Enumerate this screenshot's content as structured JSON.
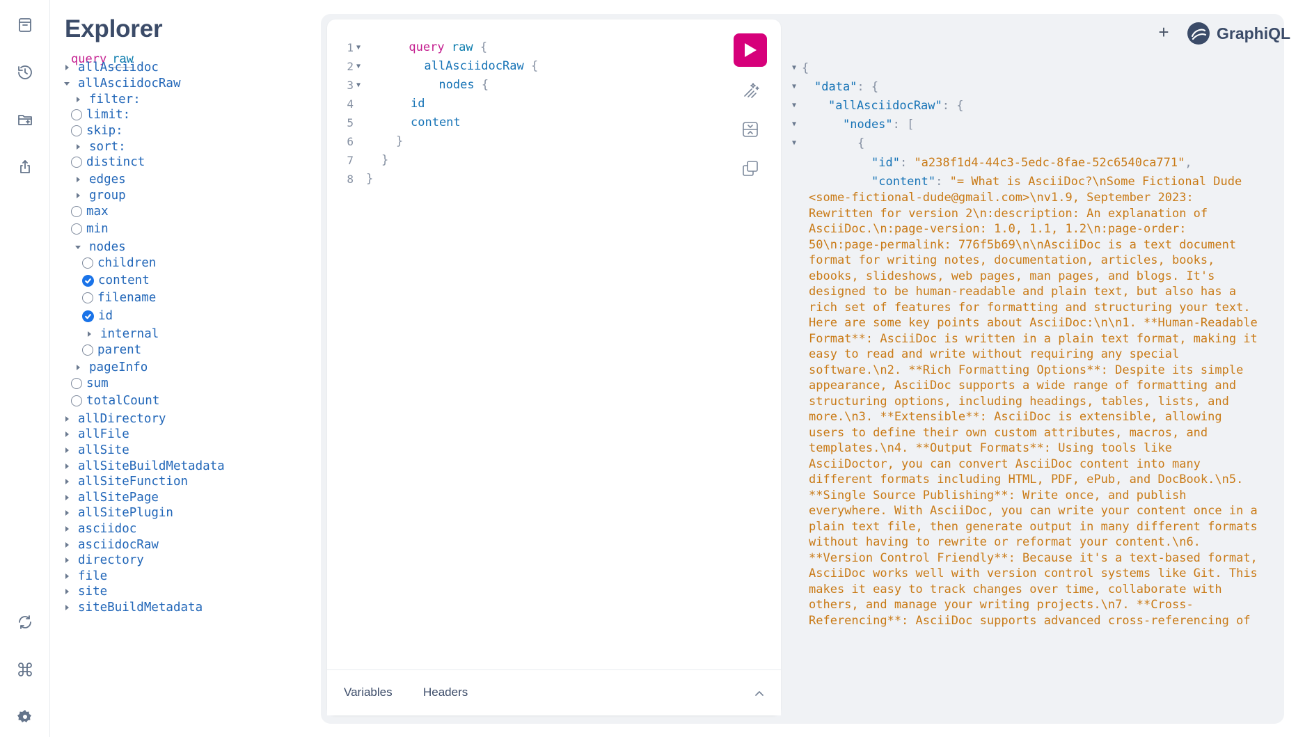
{
  "explorer": {
    "title": "Explorer",
    "op_keyword": "query",
    "op_name": "raw",
    "items": [
      {
        "label": "allAsciidoc",
        "kind": "caret-right"
      },
      {
        "label": "allAsciidocRaw",
        "kind": "caret-down"
      },
      {
        "label": "filter:",
        "kind": "caret-right"
      },
      {
        "label": "limit:",
        "kind": "radio"
      },
      {
        "label": "skip:",
        "kind": "radio"
      },
      {
        "label": "sort:",
        "kind": "caret-right"
      },
      {
        "label": "distinct",
        "kind": "radio"
      },
      {
        "label": "edges",
        "kind": "caret-right"
      },
      {
        "label": "group",
        "kind": "caret-right"
      },
      {
        "label": "max",
        "kind": "radio"
      },
      {
        "label": "min",
        "kind": "radio"
      },
      {
        "label": "nodes",
        "kind": "caret-down"
      },
      {
        "label": "children",
        "kind": "radio"
      },
      {
        "label": "content",
        "kind": "check"
      },
      {
        "label": "filename",
        "kind": "radio"
      },
      {
        "label": "id",
        "kind": "check"
      },
      {
        "label": "internal",
        "kind": "caret-right"
      },
      {
        "label": "parent",
        "kind": "radio"
      },
      {
        "label": "pageInfo",
        "kind": "caret-right"
      },
      {
        "label": "sum",
        "kind": "radio"
      },
      {
        "label": "totalCount",
        "kind": "radio"
      },
      {
        "label": "allDirectory",
        "kind": "caret-right"
      },
      {
        "label": "allFile",
        "kind": "caret-right"
      },
      {
        "label": "allSite",
        "kind": "caret-right"
      },
      {
        "label": "allSiteBuildMetadata",
        "kind": "caret-right"
      },
      {
        "label": "allSiteFunction",
        "kind": "caret-right"
      },
      {
        "label": "allSitePage",
        "kind": "caret-right"
      },
      {
        "label": "allSitePlugin",
        "kind": "caret-right"
      },
      {
        "label": "asciidoc",
        "kind": "caret-right"
      },
      {
        "label": "asciidocRaw",
        "kind": "caret-right"
      },
      {
        "label": "directory",
        "kind": "caret-right"
      },
      {
        "label": "file",
        "kind": "caret-right"
      },
      {
        "label": "site",
        "kind": "caret-right"
      },
      {
        "label": "siteBuildMetadata",
        "kind": "caret-right"
      }
    ]
  },
  "editor": {
    "line_numbers": [
      "1",
      "2",
      "3",
      "4",
      "5",
      "6",
      "7",
      "8"
    ],
    "kw_query": "query",
    "op_name": "raw",
    "brace_open": "{",
    "brace_close": "}",
    "field_all": "allAsciidocRaw",
    "field_nodes": "nodes",
    "field_id": "id",
    "field_content": "content"
  },
  "footer": {
    "variables_label": "Variables",
    "headers_label": "Headers"
  },
  "header": {
    "plus": "+",
    "logo_text": "GraphiQL"
  },
  "result": {
    "open_brace": "{",
    "key_data": "\"data\"",
    "key_all": "\"allAsciidocRaw\"",
    "key_nodes": "\"nodes\"",
    "open_bracket": "[",
    "key_id": "\"id\"",
    "val_id": "\"a238f1d4-44c3-5edc-8fae-52c6540ca771\"",
    "key_content": "\"content\"",
    "content_first": "\"= What is AsciiDoc?\\nSome Fictional Dude",
    "content_lines": [
      "<some-fictional-dude@gmail.com>\\nv1.9, September 2023:",
      "Rewritten for version 2\\n:description: An explanation of",
      "AsciiDoc.\\n:page-version: 1.0, 1.1, 1.2\\n:page-order:",
      "50\\n:page-permalink: 776f5b69\\n\\nAsciiDoc is a text document",
      "format for writing notes, documentation, articles, books,",
      "ebooks, slideshows, web pages, man pages, and blogs. It's",
      "designed to be human-readable and plain text, but also has a",
      "rich set of features for formatting and structuring your text.",
      "Here are some key points about AsciiDoc:\\n\\n1. **Human-Readable",
      "Format**: AsciiDoc is written in a plain text format, making it",
      "easy to read and write without requiring any special",
      "software.\\n2. **Rich Formatting Options**: Despite its simple",
      "appearance, AsciiDoc supports a wide range of formatting and",
      "structuring options, including headings, tables, lists, and",
      "more.\\n3. **Extensible**: AsciiDoc is extensible, allowing",
      "users to define their own custom attributes, macros, and",
      "templates.\\n4. **Output Formats**: Using tools like",
      "AsciiDoctor, you can convert AsciiDoc content into many",
      "different formats including HTML, PDF, ePub, and DocBook.\\n5.",
      "**Single Source Publishing**: Write once, and publish",
      "everywhere. With AsciiDoc, you can write your content once in a",
      "plain text file, then generate output in many different formats",
      "without having to rewrite or reformat your content.\\n6.",
      "**Version Control Friendly**: Because it's a text-based format,",
      "AsciiDoc works well with version control systems like Git. This",
      "makes it easy to track changes over time, collaborate with",
      "others, and manage your writing projects.\\n7. **Cross-",
      "Referencing**: AsciiDoc supports advanced cross-referencing of"
    ]
  },
  "colors": {
    "run_button": "#d6007a",
    "keyword": "#c41e8f",
    "field": "#1673b6",
    "string": "#c97a16",
    "checkbox": "#1a73e8"
  }
}
